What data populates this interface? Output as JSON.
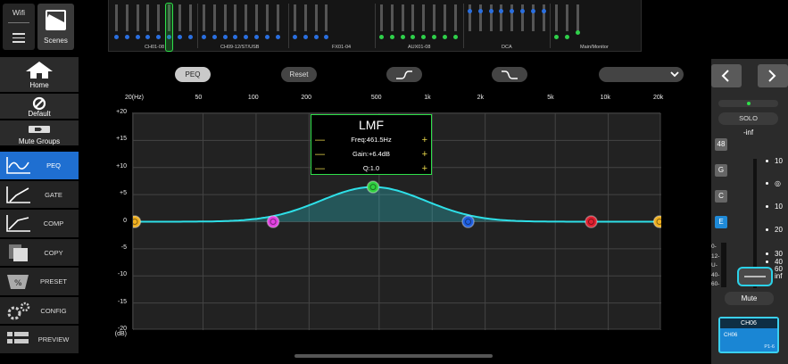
{
  "top_left": {
    "wifi_label": "Wifi",
    "scenes_label": "Scenes"
  },
  "overview": {
    "groups": [
      "CH01-08",
      "CH09-12/ST/USB",
      "FX01-04",
      "AUX01-08",
      "DCA",
      "Main/Monitor"
    ],
    "selected_channel": 6
  },
  "sidebar": {
    "home_label": "Home",
    "default_label": "Default",
    "mute_groups_label": "Mute Groups",
    "nav": [
      {
        "label": "PEQ",
        "icon": "peq-icon",
        "active": true
      },
      {
        "label": "GATE",
        "icon": "gate-icon",
        "active": false
      },
      {
        "label": "COMP",
        "icon": "comp-icon",
        "active": false
      },
      {
        "label": "COPY",
        "icon": "copy-icon",
        "active": false
      },
      {
        "label": "PRESET",
        "icon": "preset-icon",
        "active": false
      },
      {
        "label": "CONFIG",
        "icon": "config-icon",
        "active": false
      },
      {
        "label": "PREVIEW",
        "icon": "preview-icon",
        "active": false
      }
    ]
  },
  "toolbar": {
    "peq_label": "PEQ",
    "reset_label": "Reset",
    "low_shelf_icon": "low-cut-icon",
    "high_shelf_icon": "high-cut-icon"
  },
  "chart_data": {
    "type": "line",
    "x_scale": "log",
    "x_ticks": [
      "20(Hz)",
      "50",
      "100",
      "200",
      "500",
      "1k",
      "2k",
      "5k",
      "10k",
      "20k"
    ],
    "y_ticks": [
      "+20",
      "+15",
      "+10",
      "+5",
      "0",
      "-5",
      "-10",
      "-15",
      "-20"
    ],
    "y_unit_label": "(dB)",
    "ylim": [
      -20,
      20
    ],
    "xlim": [
      20,
      20000
    ],
    "grid": true,
    "bands": [
      {
        "freq": 20,
        "gain": 0,
        "color": "#f0b020"
      },
      {
        "freq": 125,
        "gain": 0,
        "color": "#e040e0"
      },
      {
        "freq": 461.5,
        "gain": 6.4,
        "color": "#30d040"
      },
      {
        "freq": 1600,
        "gain": 0,
        "color": "#2060e0"
      },
      {
        "freq": 8000,
        "gain": 0,
        "color": "#e02030"
      },
      {
        "freq": 20000,
        "gain": 0,
        "color": "#f0b020"
      }
    ],
    "curve_color": "#2ee0e8"
  },
  "band_popup": {
    "title": "LMF",
    "freq": "Freq:461.5Hz",
    "gain": "Gain:+6.4dB",
    "q": "Q:1.0"
  },
  "right_panel": {
    "solo_label": "SOLO",
    "level_label": "-inf",
    "group_buttons": [
      {
        "label": "48",
        "active": false
      },
      {
        "label": "G",
        "active": false
      },
      {
        "label": "C",
        "active": false
      },
      {
        "label": "E",
        "active": true
      }
    ],
    "meter_labels": [
      "0-",
      "12-",
      "U-",
      "40-",
      "60-"
    ],
    "fader_scale": [
      "10",
      "◎",
      "10",
      "20",
      "30",
      "40",
      "60",
      "inf"
    ],
    "mute_label": "Mute",
    "channel_tab": "CH06",
    "channel_name": "CH06",
    "channel_input": "P1-6"
  }
}
